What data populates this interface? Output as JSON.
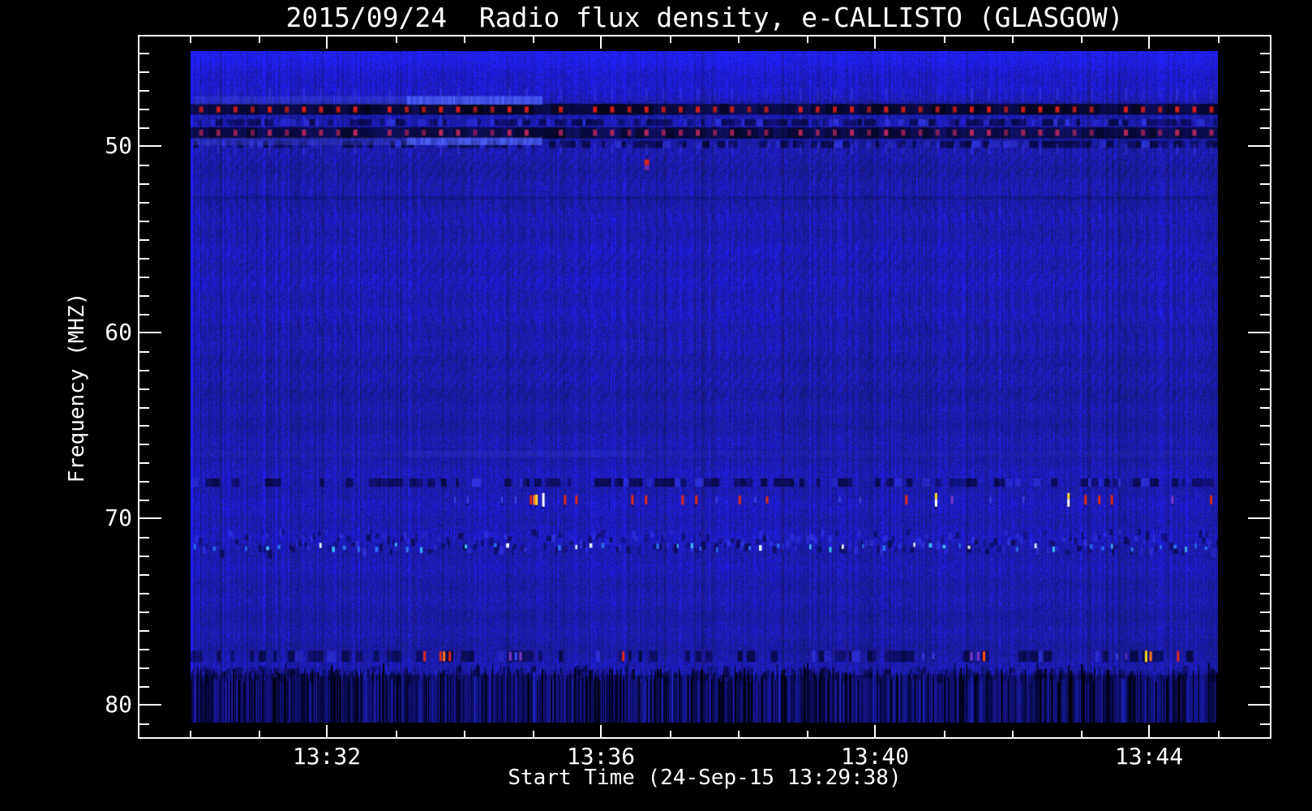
{
  "chart_data": {
    "type": "heatmap",
    "title": "2015/09/24  Radio flux density, e-CALLISTO (GLASGOW)",
    "xlabel": "Start Time (24-Sep-15 13:29:38)",
    "ylabel": "Frequency (MHZ)",
    "start_time_label": "13:29:38",
    "station": "GLASGOW",
    "date": "2015/09/24",
    "x_axis": {
      "unit": "time HH:MM, seconds measured from 13:29:38",
      "ticks_major": [
        {
          "label": "13:32",
          "sec": 142
        },
        {
          "label": "13:36",
          "sec": 382
        },
        {
          "label": "13:40",
          "sec": 622
        },
        {
          "label": "13:44",
          "sec": 862
        }
      ],
      "ticks_minor_sec": [
        22,
        82,
        202,
        262,
        322,
        442,
        502,
        562,
        682,
        742,
        802,
        922
      ],
      "image_time_range_sec": [
        22,
        922
      ]
    },
    "y_axis": {
      "unit": "MHZ",
      "inverted": true,
      "ticks_major": [
        {
          "label": "50",
          "mhz": 50
        },
        {
          "label": "60",
          "mhz": 60
        },
        {
          "label": "70",
          "mhz": 70
        },
        {
          "label": "80",
          "mhz": 80
        }
      ],
      "ticks_minor": [
        45,
        46,
        47,
        48,
        49,
        51,
        52,
        53,
        54,
        55,
        56,
        57,
        58,
        59,
        61,
        62,
        63,
        64,
        65,
        66,
        67,
        68,
        69,
        71,
        72,
        73,
        74,
        75,
        76,
        77,
        78,
        79,
        81
      ],
      "image_freq_range_mhz": [
        44.9,
        81.0
      ]
    },
    "palette": {
      "background": "#000000",
      "frame": "#ffffff",
      "text": "#ffffff",
      "base_blue": "#1112b5",
      "streak_blue": "#5269ff",
      "rfi_dark": "#02020e",
      "burst_red": "#dc2a16",
      "burst_orange": "#ff7718",
      "burst_yellow": "#ffd825",
      "burst_white": "#ffffff",
      "burst_purple": "#7838cc",
      "cyan_dot": "#3fb6f4"
    },
    "features": {
      "pulse_period_sec": 15,
      "horizontal_rfi_bands": [
        {
          "freq_mhz": [
            47.74,
            48.32
          ],
          "appearance": "near-black band with periodic red bursts"
        },
        {
          "freq_mhz": [
            49.0,
            49.6
          ],
          "appearance": "dark band with periodic red-purple bursts"
        }
      ],
      "enhanced_strips": [
        {
          "freq_mhz": [
            47.32,
            47.78
          ],
          "sec": [
            24,
            330
          ],
          "strong_after_sec": 210
        },
        {
          "freq_mhz": [
            49.55,
            49.95
          ],
          "sec": [
            24,
            330
          ],
          "strong_after_sec": 210
        }
      ],
      "dashed_noise_rows": [
        {
          "freq_mhz": [
            48.56,
            48.92
          ]
        },
        {
          "freq_mhz": [
            49.72,
            50.1
          ]
        },
        {
          "freq_mhz": [
            67.85,
            68.3
          ]
        },
        {
          "freq_mhz": [
            77.1,
            77.7
          ]
        }
      ],
      "speckle_band_72mhz": {
        "freq_mhz": [
          70.55,
          71.95
        ],
        "note": "dense speckle with bright cyan dots"
      },
      "faint_bright_row": {
        "freq_mhz": 66.35
      },
      "faint_dark_row": {
        "freq_mhz": 52.7
      },
      "point": {
        "s": 421,
        "freq_mhz": 50.9,
        "color": "red"
      },
      "broadband_noise": {
        "freq_mhz": [
          78.4,
          81.0
        ],
        "note": "vertical dark striations at bottom of band"
      },
      "dash_rows": [
        {
          "center_freq_mhz": 69.0,
          "dashes": [
            [
              253,
              "bf",
              8
            ],
            [
              264,
              "bf",
              9
            ],
            [
              294,
              "bf",
              8
            ],
            [
              306,
              "bf",
              9
            ],
            [
              319,
              "red",
              12
            ],
            [
              322,
              "orange",
              12
            ],
            [
              324,
              "yellow",
              13
            ],
            [
              330,
              "white",
              17
            ],
            [
              349,
              "red",
              12
            ],
            [
              359,
              "red",
              11
            ],
            [
              408,
              "red",
              12
            ],
            [
              420,
              "red",
              11
            ],
            [
              452,
              "red",
              12
            ],
            [
              464,
              "red",
              11
            ],
            [
              482,
              "bf",
              8
            ],
            [
              502,
              "red",
              11
            ],
            [
              516,
              "bf",
              8
            ],
            [
              526,
              "red",
              9
            ],
            [
              590,
              "bf",
              8
            ],
            [
              608,
              "bf",
              8
            ],
            [
              648,
              "red",
              12
            ],
            [
              674,
              "whitey",
              17
            ],
            [
              688,
              "purple",
              10
            ],
            [
              722,
              "bf",
              8
            ],
            [
              751,
              "bf",
              8
            ],
            [
              790,
              "whitey",
              17
            ],
            [
              805,
              "red",
              12
            ],
            [
              817,
              "red",
              11
            ],
            [
              828,
              "red",
              12
            ],
            [
              881,
              "purple",
              10
            ],
            [
              915,
              "red",
              11
            ]
          ]
        },
        {
          "center_freq_mhz": 77.4,
          "dashes": [
            [
              226,
              "red",
              13
            ],
            [
              240,
              "red",
              12
            ],
            [
              243,
              "orange",
              12
            ],
            [
              248,
              "red",
              12
            ],
            [
              301,
              "purple",
              11
            ],
            [
              306,
              "blue",
              10
            ],
            [
              310,
              "purple",
              11
            ],
            [
              400,
              "red",
              12
            ],
            [
              663,
              "bf",
              8
            ],
            [
              672,
              "bf",
              8
            ],
            [
              705,
              "purple",
              11
            ],
            [
              711,
              "purple",
              11
            ],
            [
              716,
              "or",
              12
            ],
            [
              833,
              "bf",
              8
            ],
            [
              841,
              "pf",
              8
            ],
            [
              858,
              "yellow",
              14
            ],
            [
              862,
              "orange",
              12
            ],
            [
              886,
              "red",
              13
            ]
          ]
        }
      ]
    }
  }
}
